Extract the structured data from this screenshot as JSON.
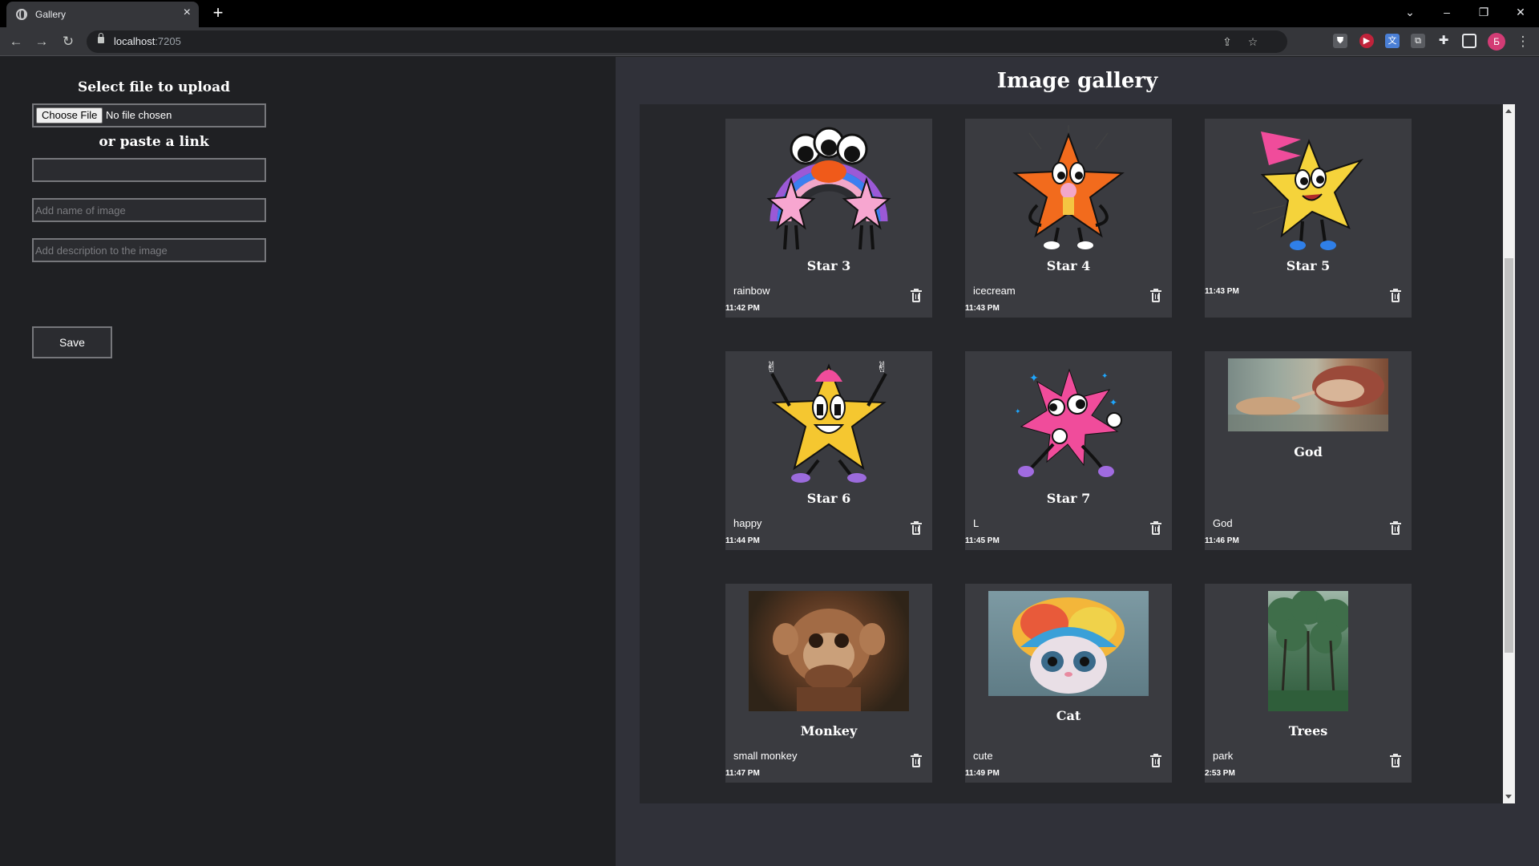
{
  "browser": {
    "tab_title": "Gallery",
    "url_host": "localhost",
    "url_port": ":7205",
    "profile_initial": "Б"
  },
  "upload": {
    "title": "Select file to upload",
    "choose_file_label": "Choose File",
    "file_status": "No file chosen",
    "or_paste_link": "or paste a link",
    "link_value": "",
    "name_placeholder": "Add name of image",
    "description_placeholder": "Add description to the image",
    "save_label": "Save"
  },
  "gallery": {
    "title": "Image gallery",
    "items": [
      {
        "name": "Star 3",
        "description": "rainbow",
        "time": "11:42 PM",
        "image": "star-rainbow"
      },
      {
        "name": "Star 4",
        "description": "icecream",
        "time": "11:43 PM",
        "image": "star-icecream"
      },
      {
        "name": "Star 5",
        "description": "",
        "time": "11:43 PM",
        "image": "star-yellow"
      },
      {
        "name": "Star 6",
        "description": "happy",
        "time": "11:44 PM",
        "image": "star-happy"
      },
      {
        "name": "Star 7",
        "description": "L",
        "time": "11:45 PM",
        "image": "star-pink"
      },
      {
        "name": "God",
        "description": "God",
        "time": "11:46 PM",
        "image": "creation-of-adam"
      },
      {
        "name": "Monkey",
        "description": "small monkey",
        "time": "11:47 PM",
        "image": "monkey-photo"
      },
      {
        "name": "Cat",
        "description": "cute",
        "time": "11:49 PM",
        "image": "cat-photo"
      },
      {
        "name": "Trees",
        "description": "park",
        "time": "2:53 PM",
        "image": "trees-photo"
      }
    ]
  }
}
